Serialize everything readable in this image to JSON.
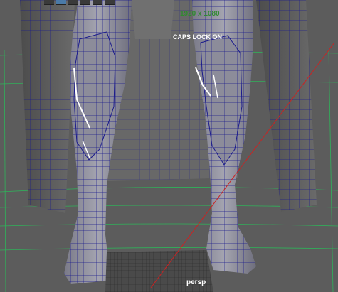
{
  "viewport": {
    "resolution_gate": "1920 x 1080",
    "caps_lock_warning": "CAPS LOCK ON",
    "camera_label": "persp"
  },
  "toolbar": {
    "icons": [
      "select-tool-icon",
      "move-tool-icon",
      "rotate-tool-icon",
      "scale-tool-icon",
      "soft-select-icon",
      "snap-icon"
    ]
  },
  "colors": {
    "background": "#5c5c5c",
    "mesh_wire": "#1a1a8c",
    "mesh_fill": "#8a8a96",
    "grid_line": "#2fb35a",
    "camera_line": "#cc2222",
    "hud_text": "#ffffff",
    "resolution_text": "#2f8a2f"
  }
}
